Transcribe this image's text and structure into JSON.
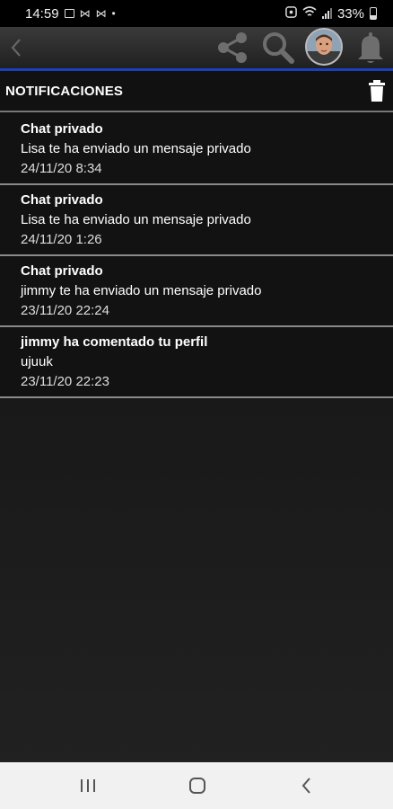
{
  "status_bar": {
    "time": "14:59",
    "battery_percent": "33%",
    "dot": "•"
  },
  "toolbar": {
    "back_icon": "chevron-left-icon",
    "share_icon": "share-icon",
    "search_icon": "search-icon",
    "avatar": "user-avatar",
    "bell_icon": "bell-icon",
    "accent_color": "#1b3fc0"
  },
  "header": {
    "title": "NOTIFICACIONES",
    "delete_icon": "trash-icon"
  },
  "notifications": [
    {
      "title": "Chat privado",
      "body": "Lisa te ha enviado un mensaje privado",
      "date": "24/11/20 8:34"
    },
    {
      "title": "Chat privado",
      "body": "Lisa te ha enviado un mensaje privado",
      "date": "24/11/20 1:26"
    },
    {
      "title": "Chat privado",
      "body": "jimmy te ha enviado un mensaje privado",
      "date": "23/11/20 22:24"
    },
    {
      "title": "jimmy ha comentado tu perfil",
      "body": "ujuuk",
      "date": "23/11/20 22:23"
    }
  ],
  "nav_bar": {
    "recents_icon": "recents-icon",
    "home_icon": "home-icon",
    "back_icon": "back-icon"
  }
}
